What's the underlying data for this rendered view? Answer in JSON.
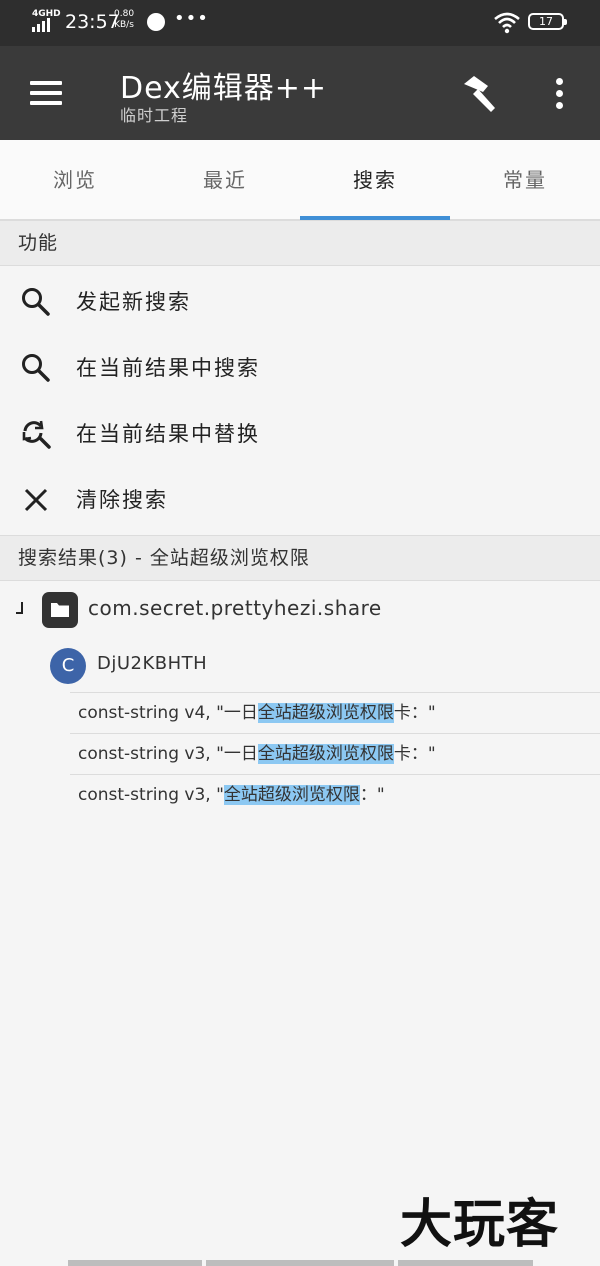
{
  "status_bar": {
    "network": "4GHD",
    "time": "23:57",
    "speed_value": "0.80",
    "speed_unit": "KB/s",
    "more": "•••",
    "battery": "17"
  },
  "app_bar": {
    "title": "Dex编辑器++",
    "subtitle": "临时工程",
    "menu_icon": "hamburger-icon",
    "build_icon": "hammer-icon",
    "overflow_icon": "more-vertical-icon"
  },
  "tabs": [
    {
      "label": "浏览"
    },
    {
      "label": "最近"
    },
    {
      "label": "搜索"
    },
    {
      "label": "常量"
    }
  ],
  "active_tab": "搜索",
  "functions": {
    "header": "功能",
    "items": [
      {
        "label": "发起新搜索",
        "icon": "search-icon"
      },
      {
        "label": "在当前结果中搜索",
        "icon": "search-icon"
      },
      {
        "label": "在当前结果中替换",
        "icon": "replace-icon"
      },
      {
        "label": "清除搜索",
        "icon": "close-icon"
      }
    ]
  },
  "results": {
    "header": "搜索结果(3) - 全站超级浏览权限",
    "package": "com.secret.prettyhezi.share",
    "class_badge": "C",
    "class_name": "DjU2KBHTH",
    "lines": [
      {
        "prefix": "const-string v4, \"一日",
        "match": "全站超级浏览权限",
        "suffix": "卡：\""
      },
      {
        "prefix": "const-string v3, \"一日",
        "match": "全站超级浏览权限",
        "suffix": "卡：\""
      },
      {
        "prefix": "const-string v3, \"",
        "match": "全站超级浏览权限",
        "suffix": "：\""
      }
    ]
  },
  "watermark": "大玩客",
  "colors": {
    "app_bar": "#3a3a3a",
    "tab_indicator": "#3f8fd6",
    "highlight": "#8cc8f2",
    "class_avatar": "#3d64a8"
  }
}
